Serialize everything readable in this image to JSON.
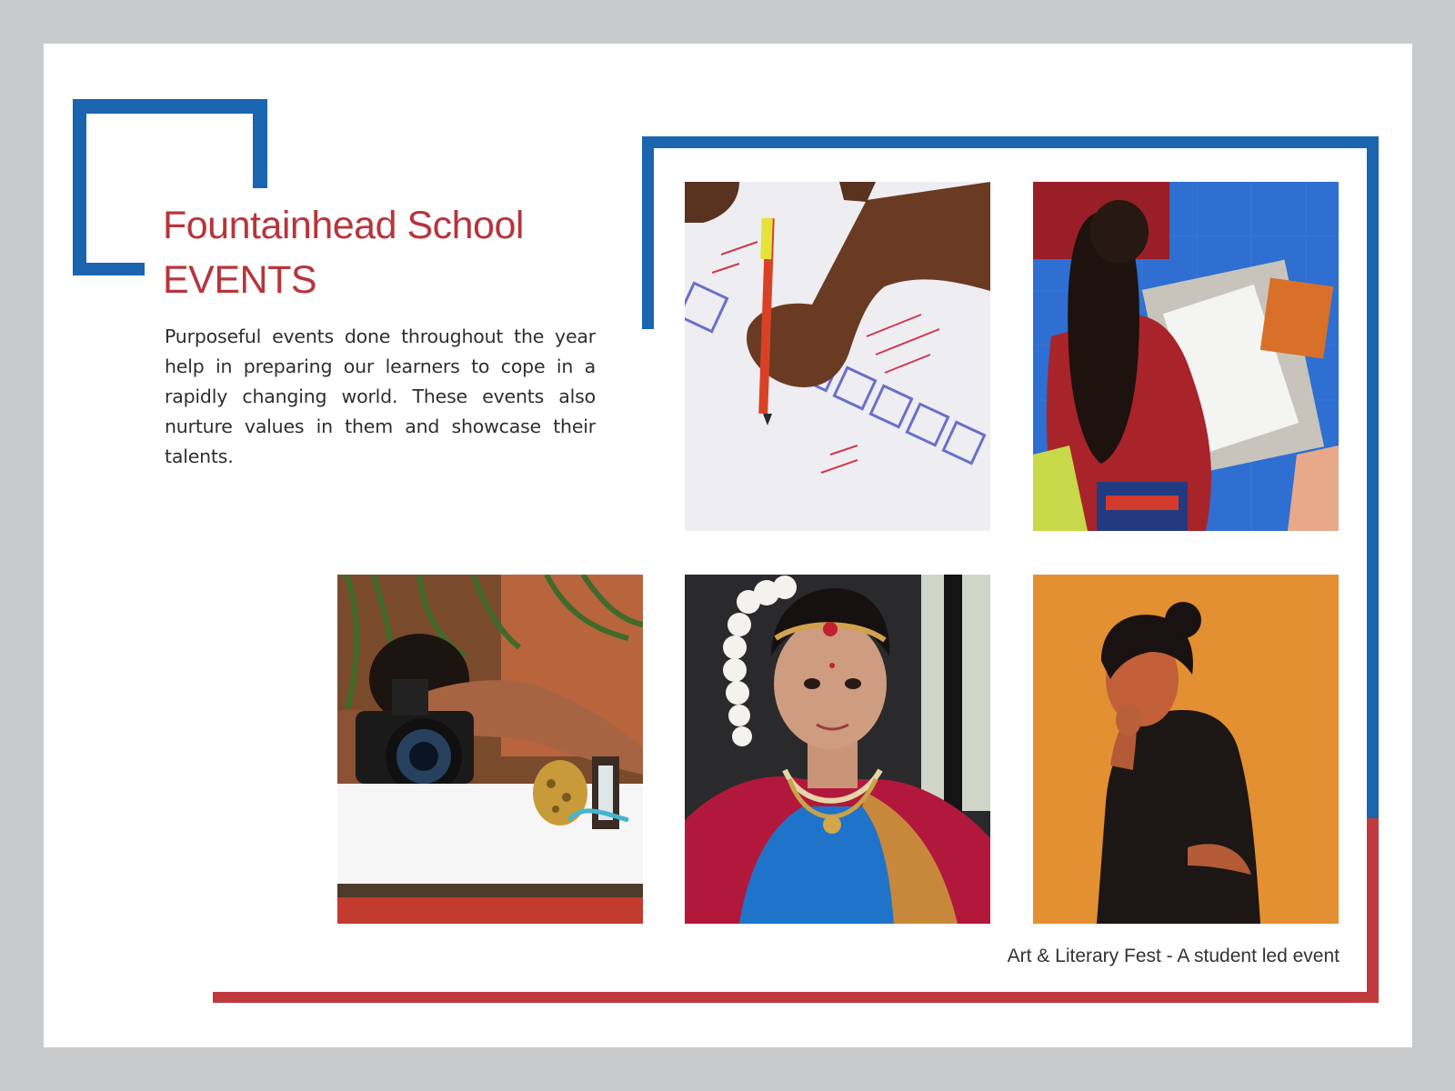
{
  "slide": {
    "title_line1": "Fountainhead School",
    "title_line2": "EVENTS",
    "description": "Purposeful events done throughout the year help in preparing our learners to cope in a rapidly changing world. These events also nurture values in them and showcase their talents.",
    "caption": "Art & Literary Fest - A student led event"
  },
  "photos": [
    {
      "subject": "hand writing letters on paper with a marker"
    },
    {
      "subject": "student drawing on paper while sitting on blue mat"
    },
    {
      "subject": "student photographing objects with a camera"
    },
    {
      "subject": "dancer in traditional costume and jewellery"
    },
    {
      "subject": "performer in black against an orange backdrop"
    }
  ],
  "colors": {
    "background": "#c8c9cb",
    "accent_blue": "#1a64b0",
    "accent_red": "#c0393f",
    "title_red": "#b7353b"
  }
}
